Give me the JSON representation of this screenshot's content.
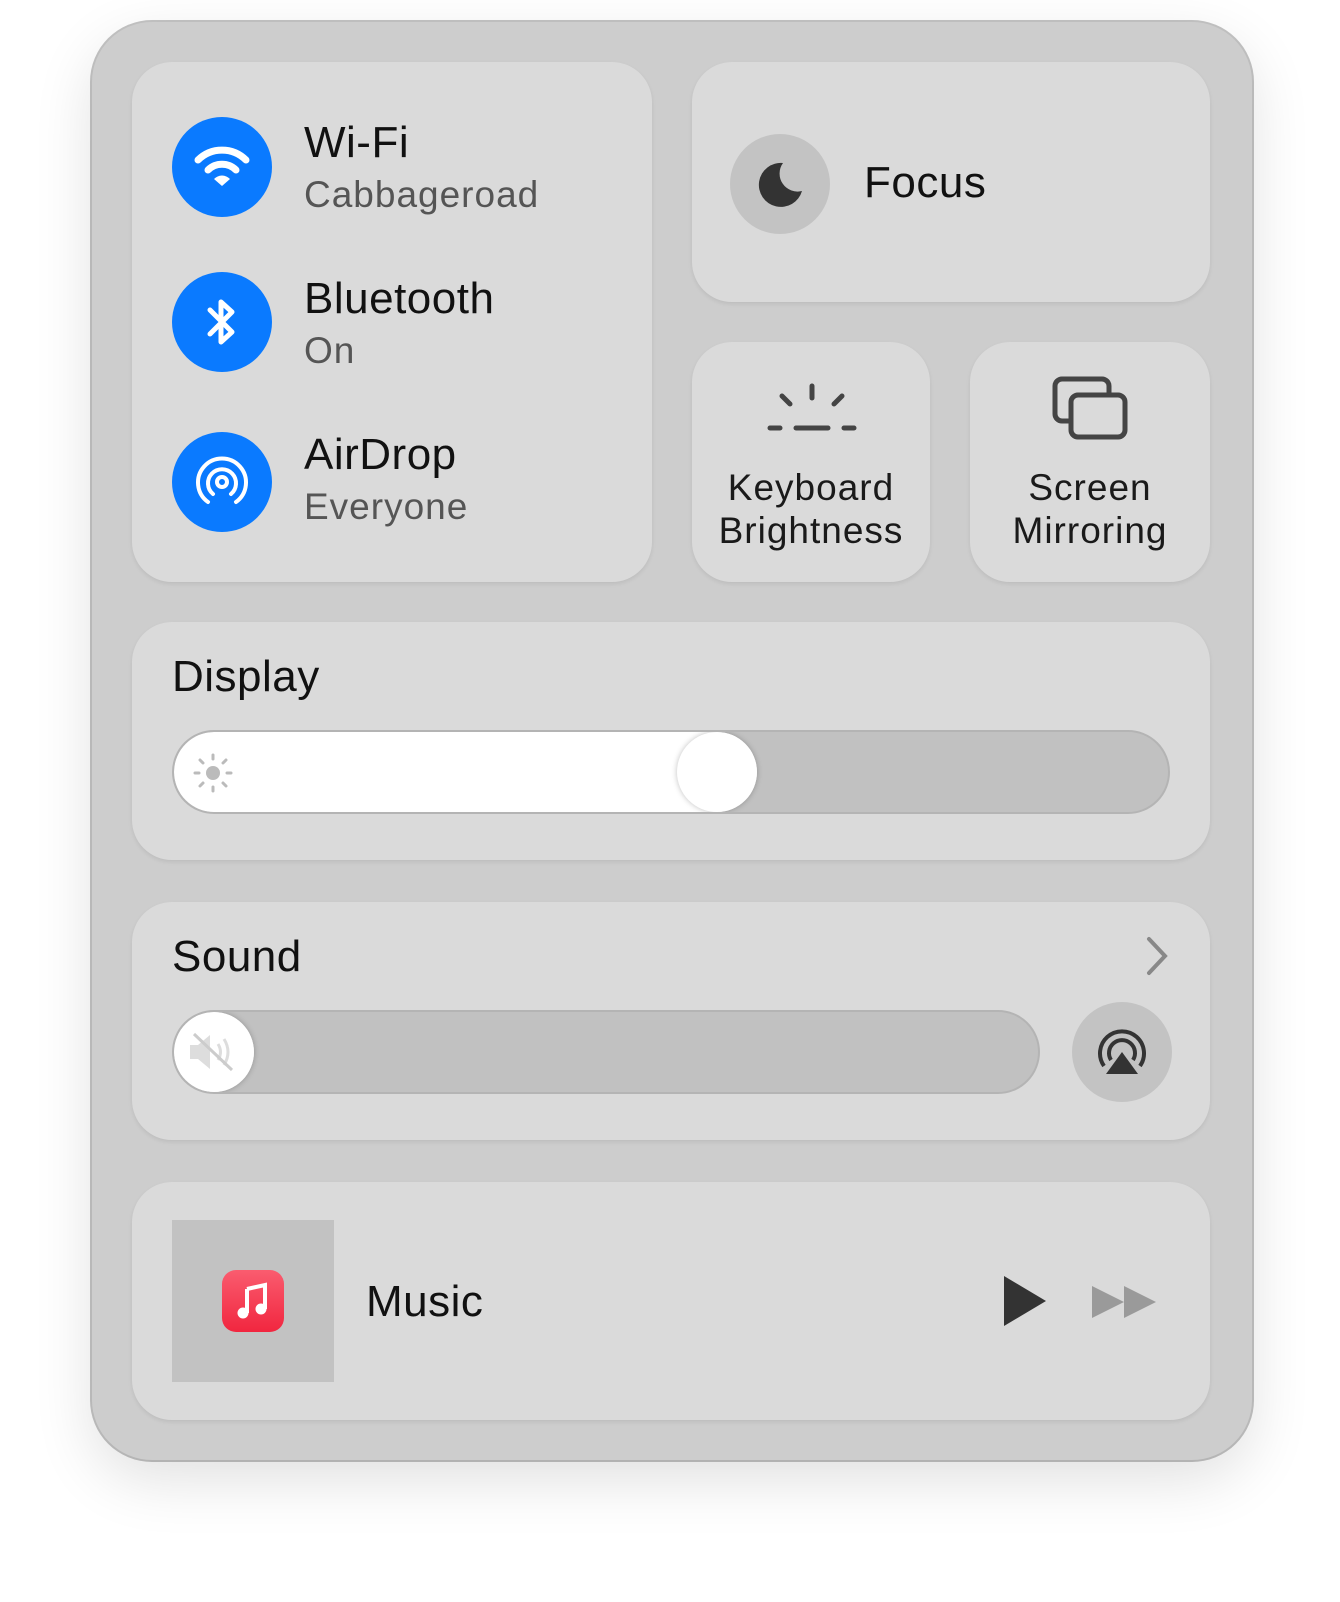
{
  "connectivity": [
    {
      "title": "Wi-Fi",
      "subtitle": "Cabbageroad",
      "icon": "wifi-icon"
    },
    {
      "title": "Bluetooth",
      "subtitle": "On",
      "icon": "bluetooth-icon"
    },
    {
      "title": "AirDrop",
      "subtitle": "Everyone",
      "icon": "airdrop-icon"
    }
  ],
  "focus": {
    "label": "Focus",
    "icon": "moon-icon"
  },
  "keyboard": {
    "line1": "Keyboard",
    "line2": "Brightness",
    "icon": "keyboard-brightness-icon"
  },
  "mirroring": {
    "line1": "Screen",
    "line2": "Mirroring",
    "icon": "screen-mirroring-icon"
  },
  "display": {
    "title": "Display",
    "brightness": 0.55,
    "icon": "sun-icon"
  },
  "sound": {
    "title": "Sound",
    "volume": 0,
    "icon": "speaker-muted-icon"
  },
  "music": {
    "title": "Music",
    "icon": "music-app-icon"
  },
  "colors": {
    "accent": "#0a7aff",
    "panel": "#cdcdcd",
    "tile": "#dadada",
    "music_icon": "#f4354f"
  }
}
